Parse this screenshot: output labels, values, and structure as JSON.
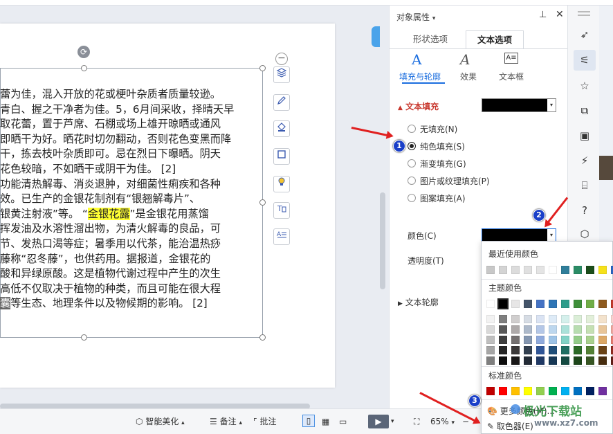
{
  "colors": {
    "accent": "#1a6ddf",
    "red_label": "#c8372d",
    "highlight": "#ffff33",
    "badge": "#1a3fc8",
    "arrow": "#e02020"
  },
  "document": {
    "lines": [
      "蕾为佳，混入开放的花或梗叶杂质者质量较逊。",
      "青白、握之干净者为佳。5，6月间采收，择晴天早",
      "取花蕾，置于芦席、石棚或场上雄开晾晒或通风",
      "即晒干为好。晒花时切勿翻动，否则花色变黑而降",
      "干，拣去枝叶杂质即可。忌在烈日下曝晒。阴天",
      "花色较暗，不如晒干或阴干为佳。 [2]",
      "功能清热解毒、消炎退肿，对细菌性痢疾和各种",
      "效。已生产的金银花制剂有“银翘解毒片”、",
      "银黄注射液”等。 “",
      "挥发油及水溶性溜出物，为清火解毒的良品，可",
      "节、发热口渴等症；暑季用以代茶，能治温热痧",
      "藤称“忍冬藤”，也供药用。据报道，金银花的",
      "酸和异绿原酸。这是植物代谢过程中产生的次生",
      "高低不仅取决于植物的种类，而且可能在很大程",
      "等生态、地理条件以及物候期的影响。 [2]"
    ],
    "highlight_word": "金银花露",
    "line9_tail": "”是金银花用蒸馏",
    "selected_char": "囊"
  },
  "floating_toolbar": [
    "minus-icon",
    "layers-icon",
    "pen-icon",
    "fill-icon",
    "frame-icon",
    "lightbulb-icon",
    "text-box-icon",
    "text-align-icon"
  ],
  "status_bar": {
    "smart_beautify": "智能美化",
    "notes": "备注",
    "comments": "批注",
    "zoom": "65%"
  },
  "panel": {
    "title": "对象属性",
    "tabs": [
      {
        "label": "形状选项"
      },
      {
        "label": "文本选项"
      }
    ],
    "subtabs": [
      {
        "label": "填充与轮廓"
      },
      {
        "label": "效果"
      },
      {
        "label": "文本框"
      }
    ],
    "text_fill_header": "文本填充",
    "fill_options": [
      {
        "label": "无填充(N)"
      },
      {
        "label": "纯色填充(S)"
      },
      {
        "label": "渐变填充(G)"
      },
      {
        "label": "图片或纹理填充(P)"
      },
      {
        "label": "图案填充(A)"
      }
    ],
    "color_label": "颜色(C)",
    "transparency_label": "透明度(T)",
    "text_outline_header": "文本轮廓",
    "fill_color": "#000000"
  },
  "color_popup": {
    "recent_title": "最近使用颜色",
    "recent": [
      "#c8c8c8",
      "#d4d4d4",
      "#dcdcdc",
      "#e0e0e0",
      "#e4e4e4",
      "#ffffff",
      "#2f7e9a",
      "#2b8c66",
      "#1b4d1b",
      "#f6e11a",
      "#2b65c2"
    ],
    "theme_title": "主题颜色",
    "theme_top": [
      "#ffffff",
      "#000000",
      "#e7e6e6",
      "#44546a",
      "#4472c4",
      "#2e75b6",
      "#2e9c8b",
      "#3f8f3a",
      "#70ad47",
      "#8e5a1e",
      "#c0392b"
    ],
    "theme_shades": [
      [
        "#f2f2f2",
        "#7f7f7f",
        "#d0cece",
        "#d6dce4",
        "#dae3f3",
        "#deebf7",
        "#d5f0ec",
        "#dbeed7",
        "#e2efd9",
        "#f3e2cc",
        "#f6d3cf"
      ],
      [
        "#d9d9d9",
        "#595959",
        "#aeaaaa",
        "#adb9ca",
        "#b4c7e7",
        "#bdd7ee",
        "#abe1d9",
        "#b8ddb0",
        "#c5e0b3",
        "#e8c599",
        "#eda79f"
      ],
      [
        "#bfbfbf",
        "#3f3f3f",
        "#757171",
        "#8496b0",
        "#8faadc",
        "#9dc3e6",
        "#82d2c6",
        "#94cc89",
        "#a9d18e",
        "#dca866",
        "#e47b6f"
      ],
      [
        "#a6a6a6",
        "#262626",
        "#3a3838",
        "#323f4f",
        "#2f5597",
        "#1f4e79",
        "#1f6f63",
        "#2c6a27",
        "#538135",
        "#6a4316",
        "#922b21"
      ],
      [
        "#7f7f7f",
        "#0d0d0d",
        "#171616",
        "#222a35",
        "#1f3864",
        "#163755",
        "#144a42",
        "#1d461a",
        "#375623",
        "#472d0f",
        "#611d16"
      ]
    ],
    "standard_title": "标准颜色",
    "standard": [
      "#c00000",
      "#ff0000",
      "#ffc000",
      "#ffff00",
      "#92d050",
      "#00b050",
      "#00b0f0",
      "#0070c0",
      "#002060",
      "#7030a0"
    ],
    "more_colors": "更多颜色(M)...",
    "eyedropper": "取色器(E)"
  },
  "annotations": {
    "badge1": "1",
    "badge2": "2",
    "badge3": "3"
  },
  "watermark": {
    "line1": "极光下载站",
    "line2": "www.xz7.com"
  }
}
